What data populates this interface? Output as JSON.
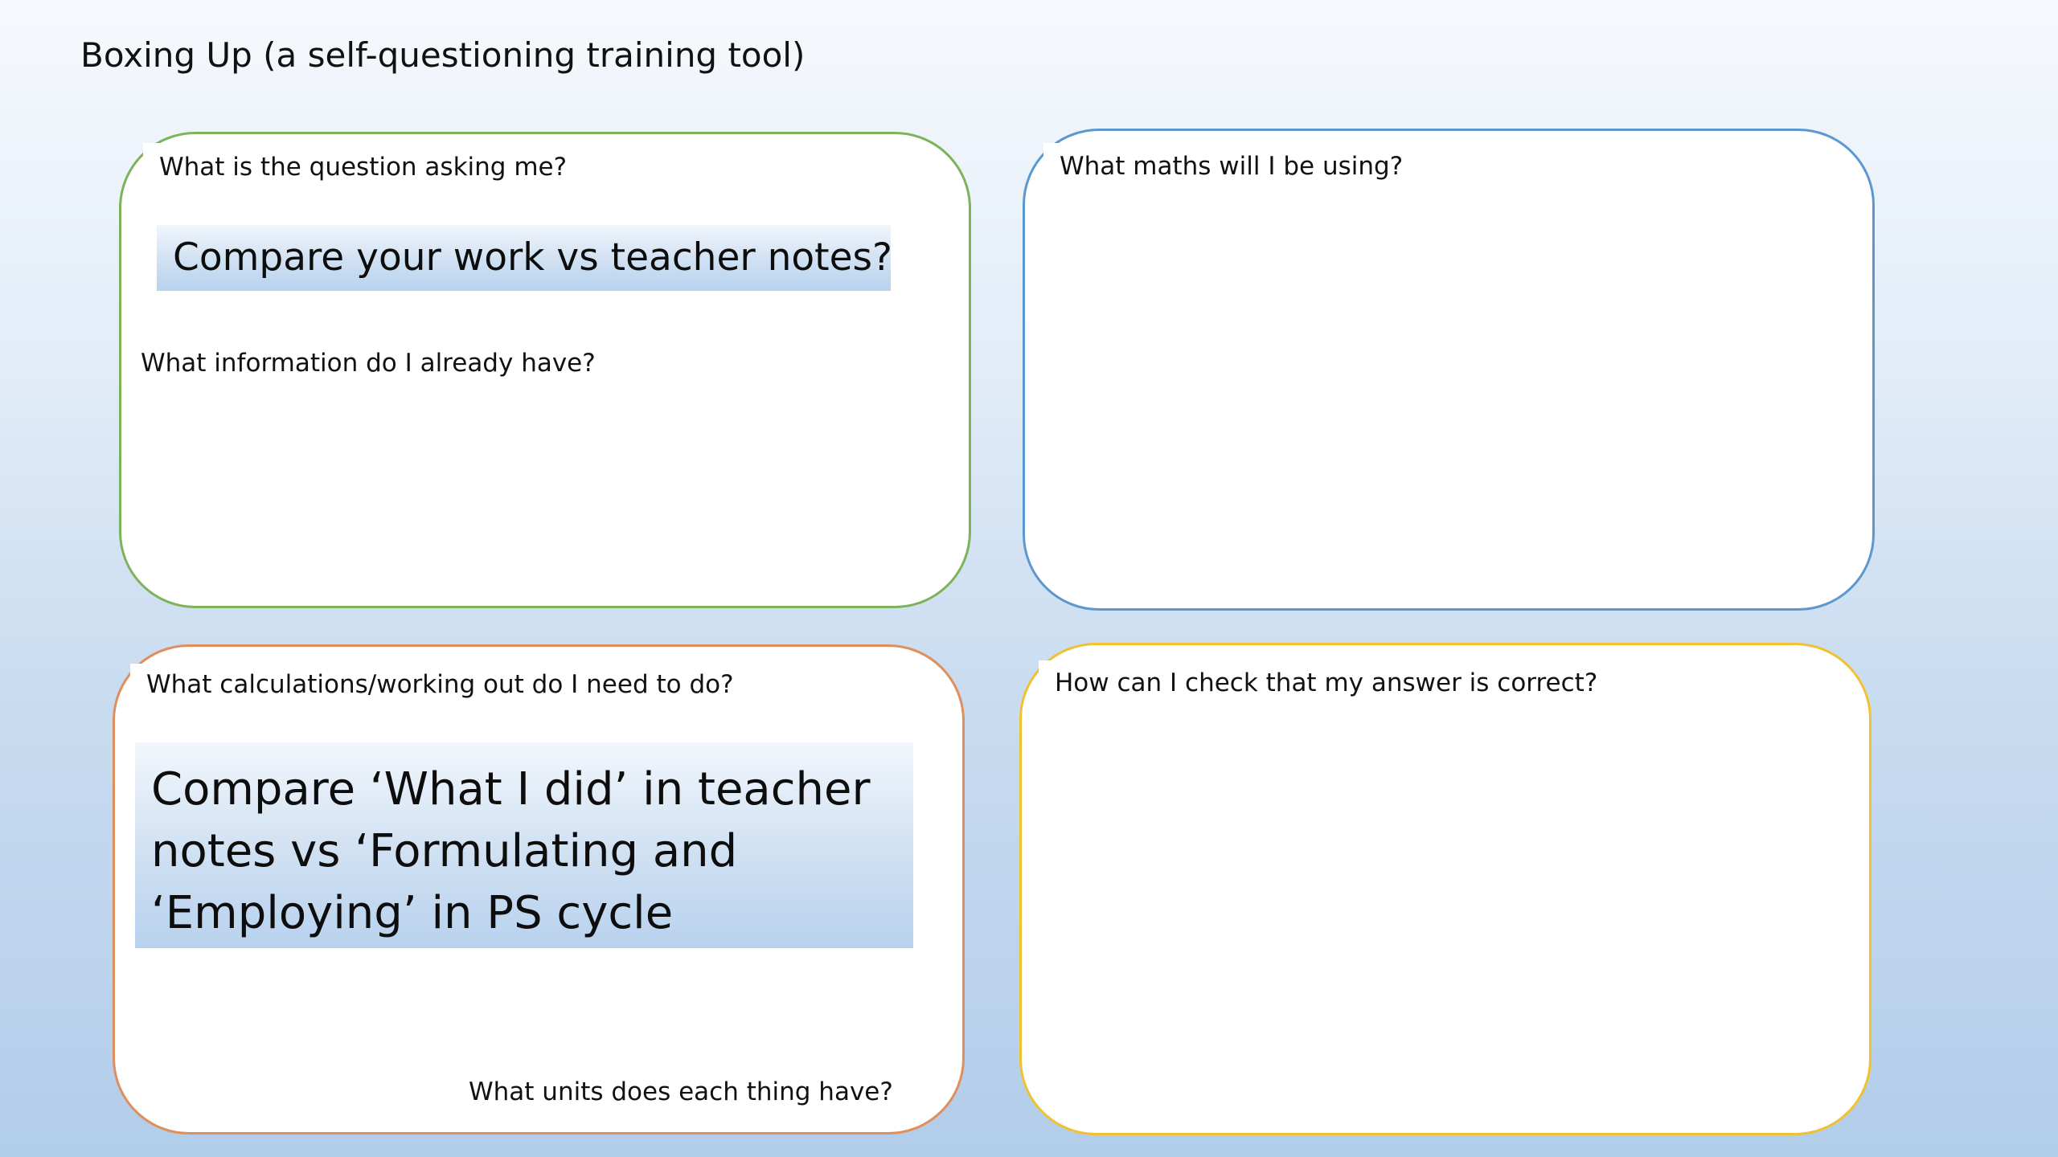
{
  "slide": {
    "title": "Boxing Up (a self-questioning training tool)"
  },
  "boxes": {
    "top_left": {
      "question": "What is the question asking me?",
      "callout": "Compare your work vs teacher notes?",
      "sub_question": "What information do I already have?"
    },
    "top_right": {
      "question": "What maths will I be using?"
    },
    "bottom_left": {
      "question": "What calculations/working out do I need to do?",
      "callout": "Compare ‘What I did’ in teacher notes vs ‘Formulating and ‘Employing’ in PS cycle",
      "sub_question": "What units does each thing have?"
    },
    "bottom_right": {
      "question": "How can I check that my answer is correct?"
    }
  },
  "colors": {
    "top_left_border": "#7db35b",
    "top_right_border": "#5c98cf",
    "bottom_left_border": "#df8f5b",
    "bottom_right_border": "#f0c131",
    "callout_fill": "#cfe0f2"
  }
}
